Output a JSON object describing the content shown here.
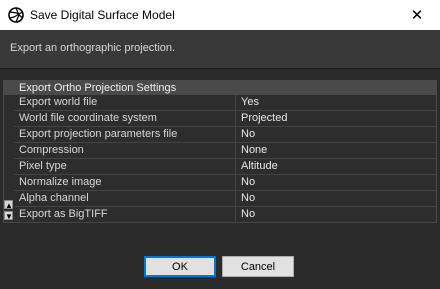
{
  "window": {
    "title": "Save Digital Surface Model",
    "close_glyph": "✕"
  },
  "description": "Export an orthographic projection.",
  "settings": {
    "section_title": "Export Ortho Projection Settings",
    "rows": [
      {
        "name": "Export world file",
        "value": "Yes"
      },
      {
        "name": "World file coordinate system",
        "value": "Projected"
      },
      {
        "name": "Export projection parameters file",
        "value": "No"
      },
      {
        "name": "Compression",
        "value": "None"
      },
      {
        "name": "Pixel type",
        "value": "Altitude"
      },
      {
        "name": "Normalize image",
        "value": "No"
      },
      {
        "name": "Alpha channel",
        "value": "No"
      },
      {
        "name": "Export as BigTIFF",
        "value": "No"
      }
    ]
  },
  "buttons": {
    "ok": "OK",
    "cancel": "Cancel"
  },
  "icons": {
    "app": "aperture-icon",
    "close": "close-icon",
    "sort_up": "sort-ascending-icon",
    "sort_down": "sort-descending-icon"
  }
}
